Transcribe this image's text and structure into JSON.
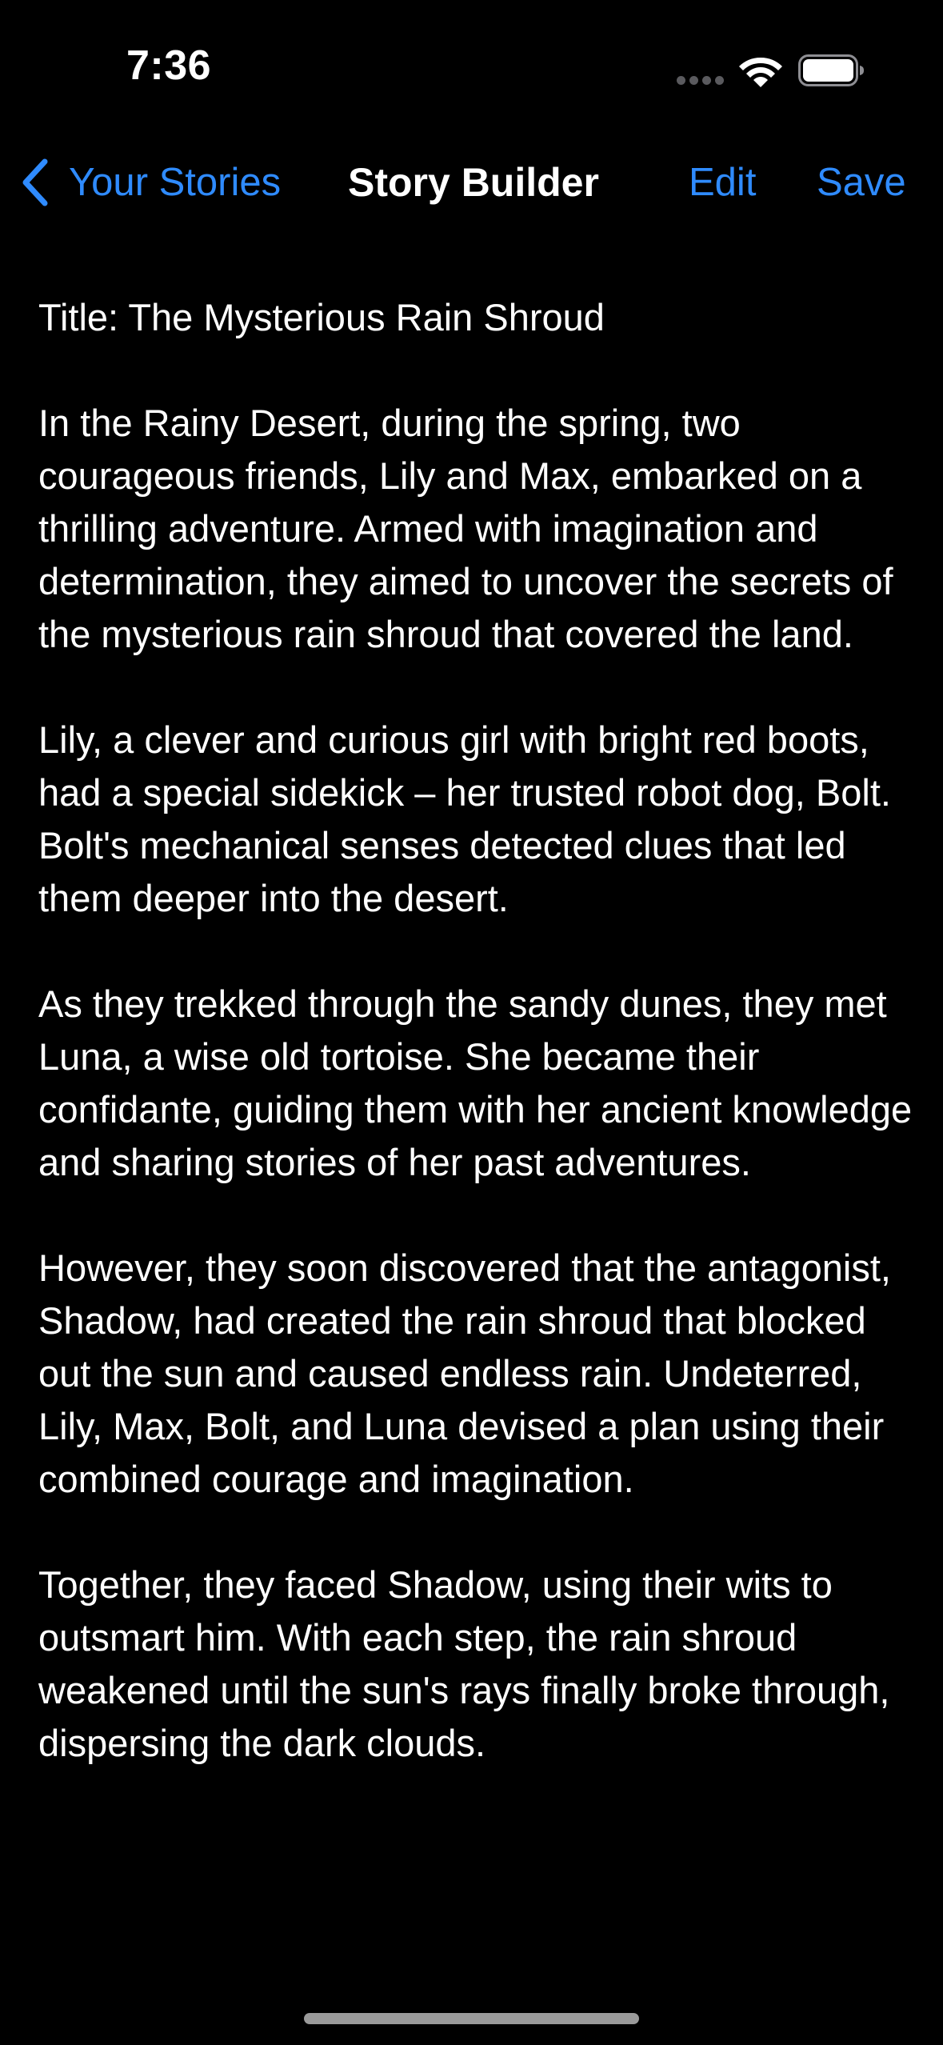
{
  "status_bar": {
    "time": "7:36",
    "icons": [
      "cellular-signal-icon",
      "wifi-icon",
      "battery-icon"
    ]
  },
  "nav": {
    "back_label": "Your Stories",
    "title": "Story Builder",
    "edit_label": "Edit",
    "save_label": "Save"
  },
  "story": {
    "title": "Title: The Mysterious Rain Shroud",
    "paragraphs": [
      "In the Rainy Desert, during the spring, two courageous friends, Lily and Max, embarked on a thrilling adventure. Armed with imagination and determination, they aimed to uncover the secrets of the mysterious rain shroud that covered the land.",
      "Lily, a clever and curious girl with bright red boots, had a special sidekick – her trusted robot dog, Bolt. Bolt's mechanical senses detected clues that led them deeper into the desert.",
      "As they trekked through the sandy dunes, they met Luna, a wise old tortoise. She became their confidante, guiding them with her ancient knowledge and sharing stories of her past adventures.",
      "However, they soon discovered that the antagonist, Shadow, had created the rain shroud that blocked out the sun and caused endless rain. Undeterred, Lily, Max, Bolt, and Luna devised a plan using their combined courage and imagination.",
      "Together, they faced Shadow, using their wits to outsmart him. With each step, the rain shroud weakened until the sun's rays finally broke through, dispersing the dark clouds."
    ]
  },
  "colors": {
    "background": "#000000",
    "text": "#ffffff",
    "accent": "#2f8bff"
  }
}
